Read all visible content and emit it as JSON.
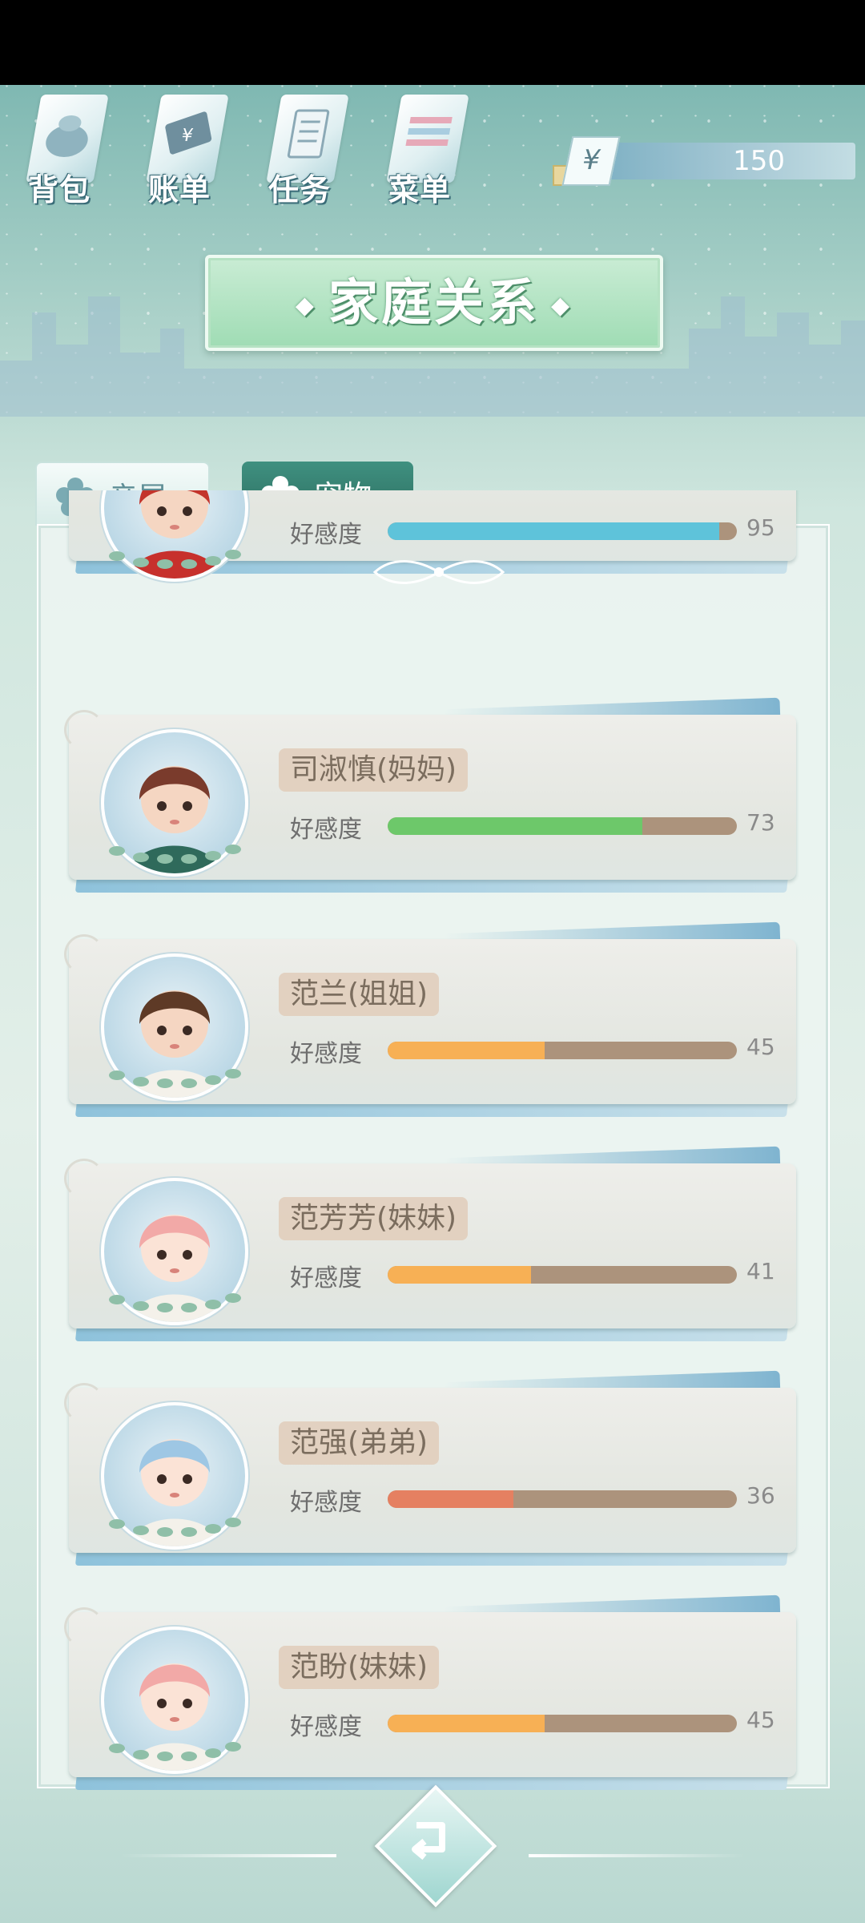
{
  "toolbar": {
    "items": [
      {
        "label": "背包",
        "icon": "bag-icon"
      },
      {
        "label": "账单",
        "icon": "bill-icon"
      },
      {
        "label": "任务",
        "icon": "task-icon"
      },
      {
        "label": "菜单",
        "icon": "menu-icon"
      }
    ]
  },
  "currency": {
    "symbol": "¥",
    "amount": "150"
  },
  "title": "家庭关系",
  "tabs": [
    {
      "label": "亲属",
      "active": true
    },
    {
      "label": "宠物",
      "active": false
    }
  ],
  "affection_label": "好感度",
  "members": [
    {
      "name": "",
      "affection": 95,
      "color": "#5ec3da"
    },
    {
      "name": "司淑慎(妈妈)",
      "affection": 73,
      "color": "#6dc86a"
    },
    {
      "name": "范兰(姐姐)",
      "affection": 45,
      "color": "#f7b055"
    },
    {
      "name": "范芳芳(妹妹)",
      "affection": 41,
      "color": "#f7b055"
    },
    {
      "name": "范强(弟弟)",
      "affection": 36,
      "color": "#e58061"
    },
    {
      "name": "范盼(妹妹)",
      "affection": 45,
      "color": "#f7b055"
    }
  ]
}
